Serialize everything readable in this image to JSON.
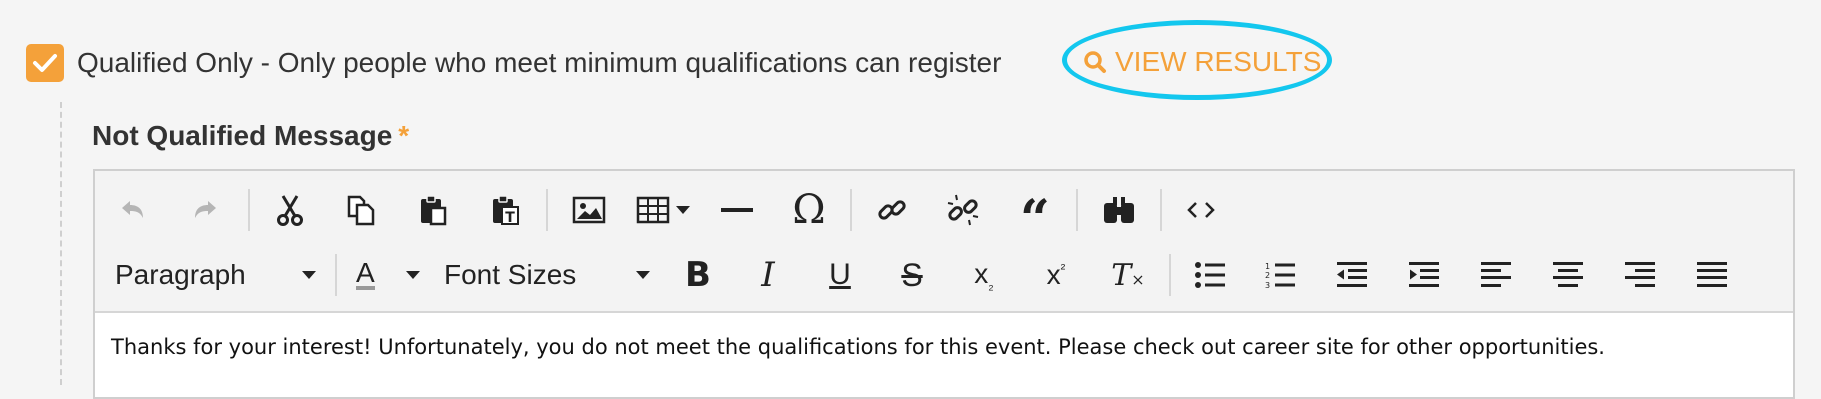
{
  "option": {
    "checked": true,
    "label": "Qualified Only - Only people who meet minimum qualifications can register"
  },
  "view_results": {
    "label": "VIEW RESULTS"
  },
  "field": {
    "title": "Not Qualified Message",
    "required_marker": "*"
  },
  "toolbar": {
    "block_format": "Paragraph",
    "font_sizes": "Font Sizes",
    "text_color_letter": "A"
  },
  "editor": {
    "content": "Thanks for your interest! Unfortunately, you do not meet the qualifications for this event. Please check out career site for other opportunities."
  },
  "colors": {
    "accent": "#f4a13a",
    "highlight": "#13c7ee"
  }
}
